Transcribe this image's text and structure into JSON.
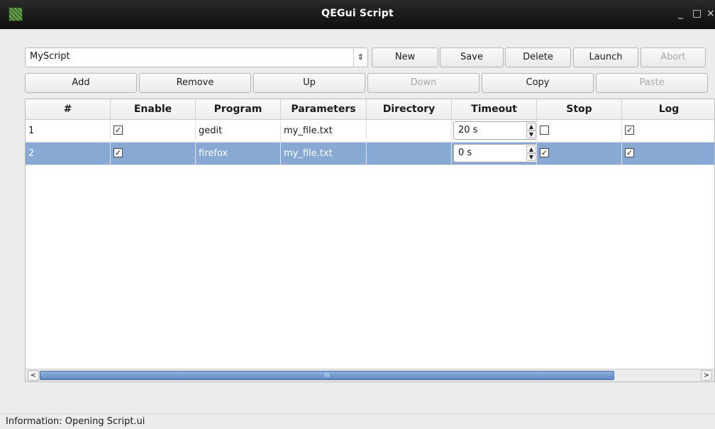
{
  "window": {
    "title": "QEGui Script",
    "controls": {
      "minimize": "_",
      "maximize": "□",
      "close": "×"
    }
  },
  "script_select": {
    "value": "MyScript",
    "arrow": "⇕"
  },
  "toolbar_top": {
    "new": "New",
    "save": "Save",
    "delete": "Delete",
    "launch": "Launch",
    "abort": "Abort"
  },
  "toolbar_edit": {
    "add": "Add",
    "remove": "Remove",
    "up": "Up",
    "down": "Down",
    "copy": "Copy",
    "paste": "Paste"
  },
  "table": {
    "columns": [
      "#",
      "Enable",
      "Program",
      "Parameters",
      "Directory",
      "Timeout",
      "Stop",
      "Log"
    ],
    "rows": [
      {
        "num": "1",
        "enable": true,
        "program": "gedit",
        "parameters": "my_file.txt",
        "directory": "",
        "timeout": "20 s",
        "stop": false,
        "log": true,
        "selected": false
      },
      {
        "num": "2",
        "enable": true,
        "program": "firefox",
        "parameters": "my_file.txt",
        "directory": "",
        "timeout": "0 s",
        "stop": true,
        "log": true,
        "selected": true
      }
    ]
  },
  "scrollbar": {
    "thumb_grip": "III",
    "left_arrow": "<",
    "right_arrow": ">"
  },
  "status": {
    "text": "Information: Opening Script.ui"
  },
  "colors": {
    "selection": "#88a9d3",
    "titlebar": "#1a1a1a",
    "scroll_thumb": "#5d87c4"
  }
}
